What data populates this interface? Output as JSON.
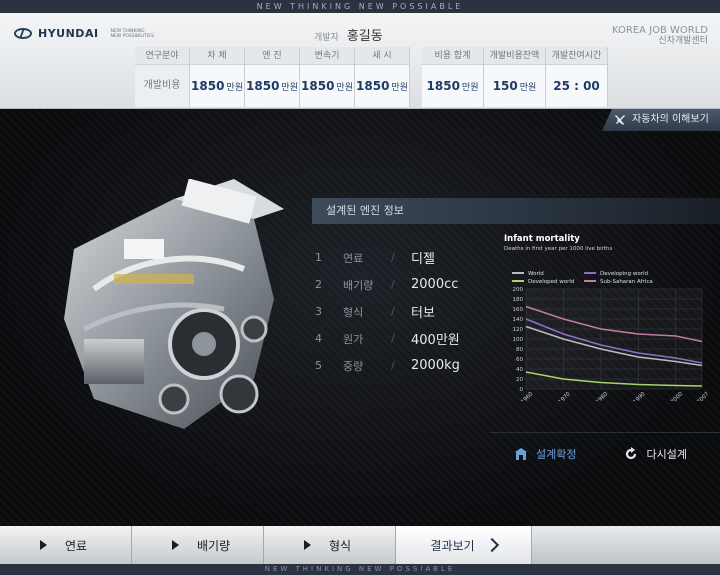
{
  "top_tagline": "NEW THINKING NEW POSSIABLE",
  "brand": {
    "name": "HYUNDAI",
    "tagline_1": "NEW THINKING",
    "tagline_2": "NEW POSSIBILITIES"
  },
  "designer": {
    "label": "개발자",
    "name": "홍길동"
  },
  "center": {
    "line1": "KOREA JOB WORLD",
    "line2": "신차개발센터"
  },
  "stats": {
    "row_label_header": "연구분야",
    "row_label_value": "개발비용",
    "cost_items": [
      {
        "label": "차 체",
        "value": "1850",
        "unit": "만원"
      },
      {
        "label": "엔 진",
        "value": "1850",
        "unit": "만원"
      },
      {
        "label": "변속기",
        "value": "1850",
        "unit": "만원"
      },
      {
        "label": "새 시",
        "value": "1850",
        "unit": "만원"
      }
    ],
    "summary": [
      {
        "label": "비용 합계",
        "value": "1850",
        "unit": "만원"
      },
      {
        "label": "개발비용잔액",
        "value": "150",
        "unit": "만원"
      },
      {
        "label": "개발잔여시간",
        "value": "25 : 00",
        "unit": ""
      }
    ]
  },
  "info_tab": "자동차의 이해보기",
  "panel_title": "설계된 엔진 정보",
  "specs": [
    {
      "num": "1",
      "name": "연료",
      "value": "디젤"
    },
    {
      "num": "2",
      "name": "배기량",
      "value": "2000cc"
    },
    {
      "num": "3",
      "name": "형식",
      "value": "터보"
    },
    {
      "num": "4",
      "name": "원가",
      "value": "400만원"
    },
    {
      "num": "5",
      "name": "중량",
      "value": "2000kg"
    }
  ],
  "chart_data": {
    "type": "line",
    "title": "Infant mortality",
    "subtitle": "Deaths in first year per 1000 live births",
    "x": [
      1960,
      1970,
      1980,
      1990,
      2000,
      2007
    ],
    "ylim": [
      0,
      200
    ],
    "yticks": [
      0,
      20,
      40,
      60,
      80,
      100,
      120,
      140,
      160,
      180,
      200
    ],
    "series": [
      {
        "name": "World",
        "color": "#b8bcc2",
        "values": [
          125,
          100,
          80,
          64,
          55,
          47
        ]
      },
      {
        "name": "Developing world",
        "color": "#8e6fc4",
        "values": [
          140,
          110,
          88,
          72,
          62,
          52
        ]
      },
      {
        "name": "Developed world",
        "color": "#a8d46a",
        "values": [
          34,
          20,
          13,
          9,
          7,
          6
        ]
      },
      {
        "name": "Sub-Saharan Africa",
        "color": "#c07aa6",
        "values": [
          165,
          140,
          120,
          110,
          106,
          95
        ]
      }
    ],
    "grid": true,
    "legend": "top"
  },
  "actions": {
    "confirm": "설계확정",
    "redo": "다시설계"
  },
  "bottom_nav": [
    {
      "label": "연료"
    },
    {
      "label": "배기량"
    },
    {
      "label": "형식"
    }
  ],
  "result_label": "결과보기",
  "footer_tagline": "NEW THINKING NEW POSSIABLE"
}
